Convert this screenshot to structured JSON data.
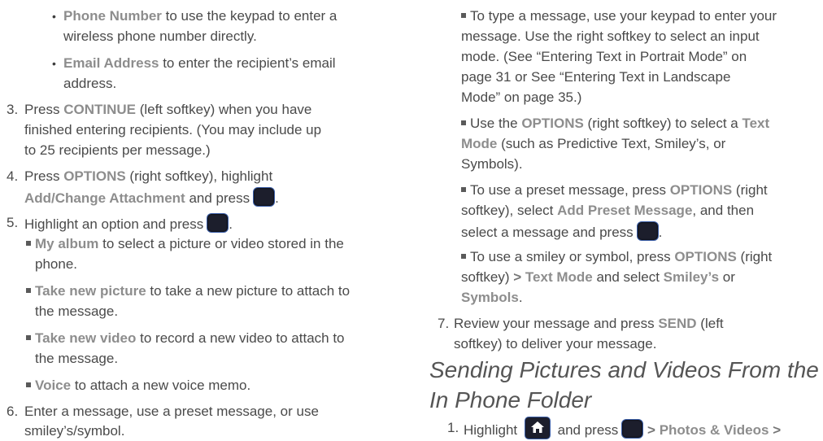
{
  "left": {
    "b1_bold": "Phone Number",
    "b1_rest_1": " to use the keypad to enter a",
    "b1_rest_2": "wireless phone number directly.",
    "b2_bold": "Email Address",
    "b2_rest_1": " to enter the recipient’s email",
    "b2_rest_2": "address.",
    "s3_num": "3.",
    "s3_pre": "Press ",
    "s3_bold": "CONTINUE",
    "s3_rest_1": " (left softkey) when you have",
    "s3_line2": "finished entering recipients. (You may include up",
    "s3_line3": "to 25 recipients per message.)",
    "s4_num": "4.",
    "s4_pre": "Press ",
    "s4_bold1": "OPTIONS",
    "s4_rest_1": " (right softkey), highlight",
    "s4_bold2": "Add/Change Attachment",
    "s4_rest_2": " and press",
    "s5_num": "5.",
    "s5_text": "Highlight an option and press",
    "o1_bold": "My album",
    "o1_rest_1": " to select a picture or video stored in the",
    "o1_rest_2": "phone.",
    "o2_bold": "Take new picture",
    "o2_rest_1": " to take a new picture to attach to",
    "o2_rest_2": "the message.",
    "o3_bold": "Take new video",
    "o3_rest_1": " to record a new video to attach to",
    "o3_rest_2": "the message.",
    "o4_bold": "Voice",
    "o4_rest_1": " to attach a new voice memo.",
    "s6_num": "6.",
    "s6_line1": "Enter a message, use a preset message, or use",
    "s6_line2": "smiley’s/symbol."
  },
  "right": {
    "r1_l1": "To type a message, use your keypad to enter your",
    "r1_l2": "message. Use the right softkey to select an input",
    "r1_l3": "mode. (See “Entering Text in Portrait Mode” on",
    "r1_l4": "page 31 or See “Entering Text in Landscape",
    "r1_l5": "Mode” on page 35.)",
    "r2_pre": "Use the ",
    "r2_bold1": "OPTIONS",
    "r2_mid": " (right softkey) to select a ",
    "r2_bold2": "Text",
    "r2_bold3": "Mode",
    "r2_rest_2": " (such as Predictive Text, Smiley’s, or",
    "r2_l3": "Symbols).",
    "r3_pre": "To use a preset message, press ",
    "r3_bold1": "OPTIONS",
    "r3_rest_1": " (right",
    "r3_l2_pre": "softkey), select ",
    "r3_bold2": "Add Preset Message",
    "r3_l2_rest": ", and then",
    "r3_l3": "select a message and press",
    "r4_pre": "To use a smiley or symbol, press ",
    "r4_bold1": "OPTIONS",
    "r4_rest_1": " (right",
    "r4_l2_pre": "softkey) ",
    "r4_gt": ">",
    "r4_bold2": " Text Mode",
    "r4_l2_mid": " and select ",
    "r4_bold3": "Smiley’s",
    "r4_l2_rest": " or",
    "r4_bold4": "Symbols",
    "r4_l3_rest": ".",
    "s7_num": "7.",
    "s7_pre": "Review your message and press ",
    "s7_bold": "SEND",
    "s7_rest_1": " (left",
    "s7_l2": "softkey) to deliver your message.",
    "heading_l1": "Sending Pictures and Videos From the",
    "heading_l2": "In Phone Folder",
    "s1_num": "1.",
    "s1_pre": "Highlight",
    "s1_mid": "and press",
    "s1_gt1": ">",
    "s1_bold": " Photos & Videos ",
    "s1_gt2": ">"
  }
}
